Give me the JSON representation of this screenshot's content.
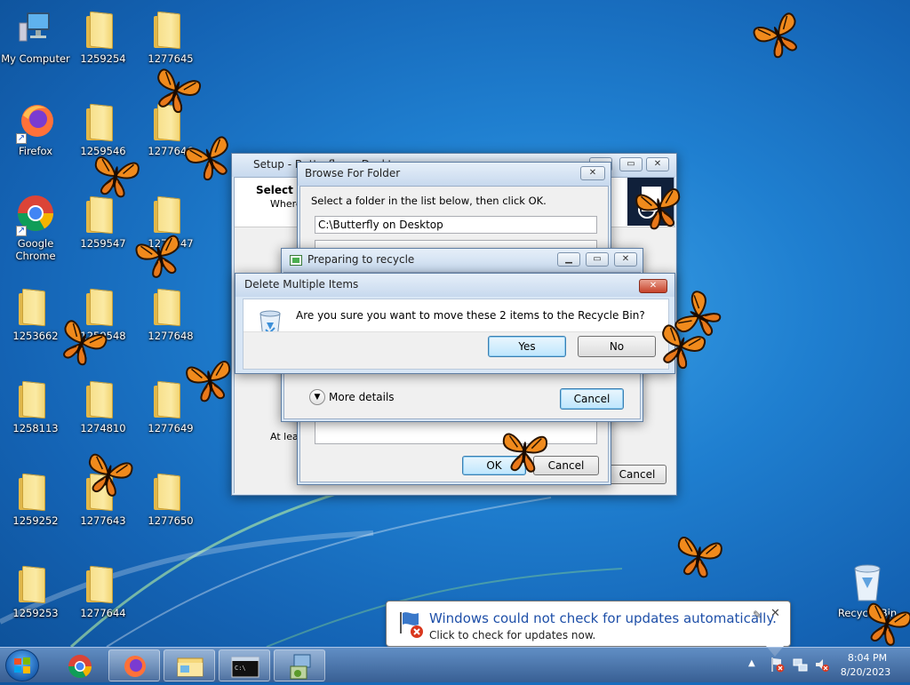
{
  "desktop": {
    "icons": [
      {
        "label": "My Computer",
        "kind": "computer-icon"
      },
      {
        "label": "1259254",
        "kind": "folder-icon"
      },
      {
        "label": "1277645",
        "kind": "folder-icon"
      },
      {
        "label": "Firefox",
        "kind": "firefox-icon"
      },
      {
        "label": "1259546",
        "kind": "folder-icon"
      },
      {
        "label": "1277646",
        "kind": "folder-icon"
      },
      {
        "label": "Google Chrome",
        "kind": "chrome-icon"
      },
      {
        "label": "1259547",
        "kind": "folder-icon"
      },
      {
        "label": "1277647",
        "kind": "folder-icon"
      },
      {
        "label": "1253662",
        "kind": "folder-icon"
      },
      {
        "label": "1259548",
        "kind": "folder-icon"
      },
      {
        "label": "1277648",
        "kind": "folder-icon"
      },
      {
        "label": "1258113",
        "kind": "folder-icon"
      },
      {
        "label": "1274810",
        "kind": "folder-icon"
      },
      {
        "label": "1277649",
        "kind": "folder-icon"
      },
      {
        "label": "1259252",
        "kind": "folder-icon"
      },
      {
        "label": "1277643",
        "kind": "folder-icon"
      },
      {
        "label": "1277650",
        "kind": "folder-icon"
      },
      {
        "label": "1259253",
        "kind": "folder-icon"
      },
      {
        "label": "1277644",
        "kind": "folder-icon"
      },
      {
        "label": "Recycle Bin",
        "kind": "recycle-bin-icon"
      }
    ]
  },
  "setup_window": {
    "title": "Setup - Butterfly on Desktop",
    "select_heading": "Select Destination Location",
    "where_text": "Where should Butterfly on Desktop be installed?",
    "at_least_text": "At least 1.9 MB of free disk space is required.",
    "cancel_label": "Cancel"
  },
  "browse_dialog": {
    "title": "Browse For Folder",
    "instruction": "Select a folder in the list below, then click OK.",
    "path_value": "C:\\Butterfly on Desktop",
    "ok_label": "OK",
    "cancel_label": "Cancel"
  },
  "preparing_window": {
    "title": "Preparing to recycle",
    "more_details_label": "More details",
    "cancel_label": "Cancel"
  },
  "delete_dialog": {
    "title": "Delete Multiple Items",
    "message": "Are you sure you want to move these 2 items to the Recycle Bin?",
    "yes_label": "Yes",
    "no_label": "No"
  },
  "notification": {
    "title": "Windows could not check for updates automatically.",
    "subtitle": "Click to check for updates now."
  },
  "taskbar": {
    "items": [
      "start-button",
      "chrome-taskbar-button",
      "firefox-taskbar-button",
      "explorer-taskbar-button",
      "cmd-taskbar-button",
      "setup-taskbar-button"
    ],
    "clock_time": "8:04 PM",
    "clock_date": "8/20/2023"
  },
  "colors": {
    "desktop_blue": "#1f7fd0",
    "butterfly_orange": "#f08a1c",
    "notification_title": "#1e4fa8"
  }
}
